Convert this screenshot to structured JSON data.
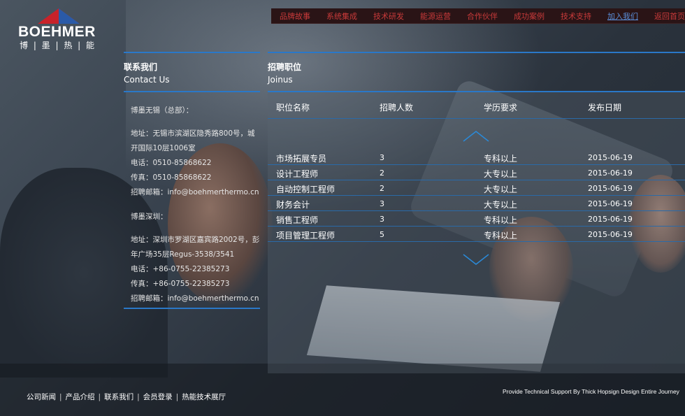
{
  "logo": {
    "wordmark": "BOEHMER",
    "chinese": "博 | 墨 | 热 | 能"
  },
  "nav": {
    "items": [
      "品牌故事",
      "系统集成",
      "技术研发",
      "能源运营",
      "合作伙伴",
      "成功案例",
      "技术支持",
      "加入我们",
      "返回首页"
    ],
    "active_index": 7
  },
  "contact": {
    "title_cn": "联系我们",
    "title_en": "Contact Us",
    "wuxi": {
      "heading": "博墨无锡（总部）：",
      "address": "地址：无锡市滨湖区隐秀路800号，城开国际10层1006室",
      "phone": "电话：0510-85868622",
      "fax": "传真：0510-85868622",
      "email": "招聘邮箱：info@boehmerthermo.cn"
    },
    "shenzhen": {
      "heading": "博墨深圳：",
      "address": "地址：深圳市罗湖区嘉宾路2002号，彭年广场35层Regus-3538/3541",
      "phone": "电话：+86-0755-22385273",
      "fax": "传真：+86-0755-22385273",
      "email": "招聘邮箱：info@boehmerthermo.cn"
    }
  },
  "jobs": {
    "title_cn": "招聘职位",
    "title_en": "Joinus",
    "columns": [
      "职位名称",
      "招聘人数",
      "学历要求",
      "发布日期"
    ],
    "rows": [
      [
        "市场拓展专员",
        "3",
        "专科以上",
        "2015-06-19"
      ],
      [
        "设计工程师",
        "2",
        "大专以上",
        "2015-06-19"
      ],
      [
        "自动控制工程师",
        "2",
        "大专以上",
        "2015-06-19"
      ],
      [
        "财务会计",
        "3",
        "大专以上",
        "2015-06-19"
      ],
      [
        "销售工程师",
        "3",
        "专科以上",
        "2015-06-19"
      ],
      [
        "项目管理工程师",
        "5",
        "专科以上",
        "2015-06-19"
      ]
    ]
  },
  "footer": {
    "links": [
      "公司新闻",
      "产品介绍",
      "联系我们",
      "会员登录",
      "热能技术展厅"
    ],
    "credit": "Provide Technical Support By Thick Hopsign Design Entire Journey"
  },
  "colors": {
    "accent_blue": "#2a78c8",
    "nav_red": "#c83a3a",
    "nav_active": "#5a8ed8",
    "logo_red": "#c8222a",
    "logo_blue": "#2a5aa8"
  }
}
